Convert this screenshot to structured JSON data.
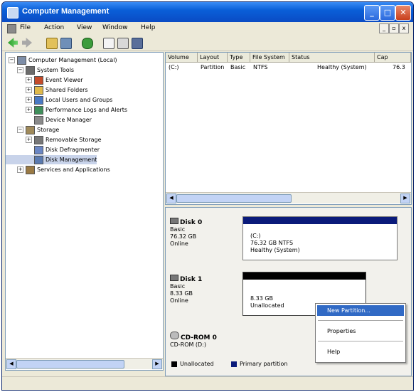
{
  "window": {
    "title": "Computer Management"
  },
  "titlebar_buttons": {
    "minimize": "_",
    "maximize": "□",
    "close": "✕"
  },
  "menubar": {
    "items": [
      "File",
      "Action",
      "View",
      "Window",
      "Help"
    ],
    "mdi_controls": [
      "_",
      "▫",
      "x"
    ]
  },
  "toolbar": {
    "icons": [
      "back-arrow-icon",
      "forward-arrow-icon",
      "up-folder-icon",
      "show-hide-tree-icon",
      "refresh-icon",
      "export-list-icon",
      "properties-icon",
      "help-icon"
    ]
  },
  "tree": {
    "items": [
      {
        "label": "Computer Management (Local)",
        "expander": "−",
        "icon": "computer-icon",
        "indent": 0
      },
      {
        "label": "System Tools",
        "expander": "−",
        "icon": "toolbox-icon",
        "indent": 1
      },
      {
        "label": "Event Viewer",
        "expander": "+",
        "icon": "event-viewer-icon",
        "indent": 2
      },
      {
        "label": "Shared Folders",
        "expander": "+",
        "icon": "shared-folders-icon",
        "indent": 2
      },
      {
        "label": "Local Users and Groups",
        "expander": "+",
        "icon": "users-icon",
        "indent": 2
      },
      {
        "label": "Performance Logs and Alerts",
        "expander": "+",
        "icon": "performance-icon",
        "indent": 2
      },
      {
        "label": "Device Manager",
        "expander": "",
        "icon": "device-manager-icon",
        "indent": 2
      },
      {
        "label": "Storage",
        "expander": "−",
        "icon": "storage-icon",
        "indent": 1
      },
      {
        "label": "Removable Storage",
        "expander": "+",
        "icon": "removable-storage-icon",
        "indent": 2
      },
      {
        "label": "Disk Defragmenter",
        "expander": "",
        "icon": "defrag-icon",
        "indent": 2
      },
      {
        "label": "Disk Management",
        "expander": "",
        "icon": "disk-management-icon",
        "indent": 2,
        "selected": true
      },
      {
        "label": "Services and Applications",
        "expander": "+",
        "icon": "services-icon",
        "indent": 1
      }
    ]
  },
  "volume_list": {
    "columns": [
      "Volume",
      "Layout",
      "Type",
      "File System",
      "Status",
      "Cap"
    ],
    "rows": [
      {
        "volume": "(C:)",
        "layout": "Partition",
        "type": "Basic",
        "fs": "NTFS",
        "status": "Healthy (System)",
        "cap": "76.3"
      }
    ]
  },
  "disks": [
    {
      "name": "Disk 0",
      "type": "Basic",
      "size": "76.32 GB",
      "state": "Online",
      "partition": {
        "line1": "(C:)",
        "line2": "76.32 GB NTFS",
        "line3": "Healthy (System)"
      }
    },
    {
      "name": "Disk 1",
      "type": "Basic",
      "size": "8.33 GB",
      "state": "Online",
      "partition": {
        "line1": "8.33 GB",
        "line2": "Unallocated"
      }
    },
    {
      "name": "CD-ROM 0",
      "type": "CD-ROM (D:)",
      "size": "",
      "state": ""
    }
  ],
  "legend": {
    "unallocated": "Unallocated",
    "primary": "Primary partition"
  },
  "context_menu": {
    "items": [
      "New Partition...",
      "Properties",
      "Help"
    ]
  },
  "colors": {
    "primary_partition": "#0a1a7a",
    "unallocated": "#000000",
    "selection": "#316ac5",
    "title_bar": "#0a5fd8"
  }
}
